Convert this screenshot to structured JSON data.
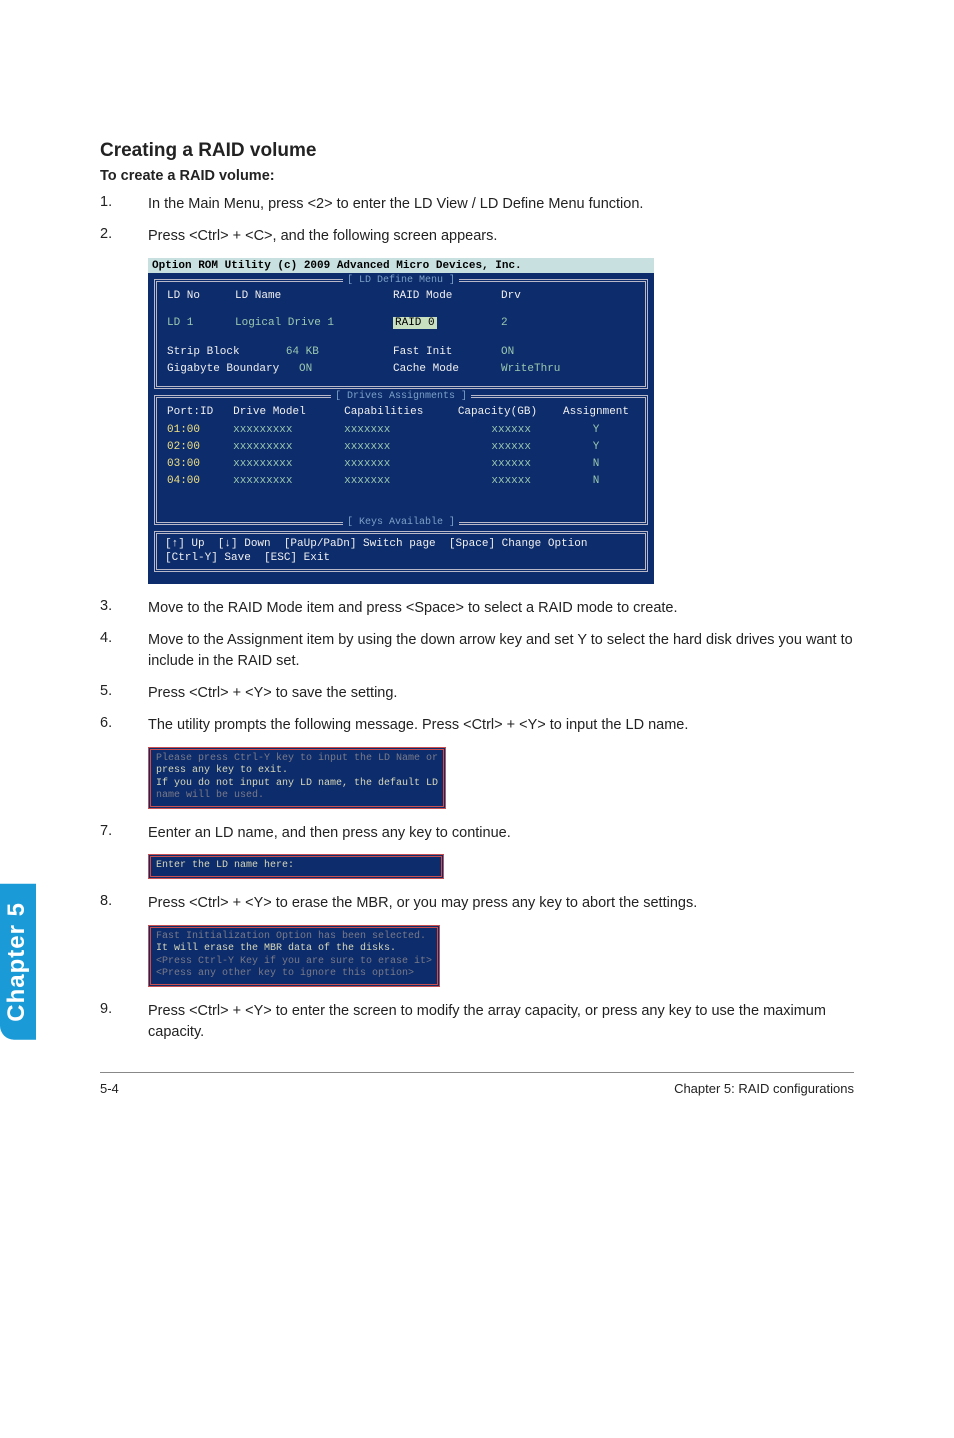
{
  "section": {
    "title": "Creating a RAID volume",
    "subhead": "To create a RAID volume:"
  },
  "steps": {
    "n1": "1.",
    "t1": "In the Main Menu, press <2> to enter the LD View / LD Define Menu function.",
    "n2": "2.",
    "t2": "Press <Ctrl> + <C>, and the following screen appears.",
    "n3": "3.",
    "t3": "Move to the RAID Mode item and press <Space> to select a RAID mode to create.",
    "n4": "4.",
    "t4": "Move to the Assignment item by using the down arrow key and set Y to select the hard disk drives you want to include in the RAID set.",
    "n5": "5.",
    "t5": "Press <Ctrl> + <Y> to save the setting.",
    "n6": "6.",
    "t6": "The utility prompts the following message. Press <Ctrl> + <Y> to input the LD name.",
    "n7": "7.",
    "t7": "Eenter an LD name, and then press any key to continue.",
    "n8": "8.",
    "t8": "Press <Ctrl> + <Y> to erase the MBR, or you may press any key to abort the settings.",
    "n9": "9.",
    "t9": "Press <Ctrl> + <Y> to enter the screen to modify the array capacity, or press any key to use the maximum capacity."
  },
  "bios": {
    "title": "Option ROM Utility (c) 2009 Advanced Micro Devices, Inc.",
    "panel1_label": "[ LD Define Menu ]",
    "panel2_label": "[ Drives Assignments ]",
    "panel3_label": "[ Keys Available ]",
    "ld_no_hdr": "LD No",
    "ld_name_hdr": "LD Name",
    "raid_mode_hdr": "RAID Mode",
    "drv_hdr": "Drv",
    "ld_row_no": "LD  1",
    "ld_row_name": "Logical Drive 1",
    "raid_mode_val": " RAID 0 ",
    "drv_val": "2",
    "strip_block_lbl": "Strip Block",
    "strip_block_val": "64 KB",
    "fast_init_lbl": "Fast Init",
    "fast_init_val": "ON",
    "gig_lbl": "Gigabyte Boundary",
    "gig_val": "ON",
    "cache_lbl": "Cache Mode",
    "cache_val": "WriteThru",
    "col_port": "Port:ID",
    "col_model": "Drive Model",
    "col_cap": "Capabilities",
    "col_size": "Capacity(GB)",
    "col_assign": "Assignment",
    "rows": [
      {
        "port": "01:00",
        "model": "xxxxxxxxx",
        "cap": "xxxxxxx",
        "size": "xxxxxx",
        "assign": "Y"
      },
      {
        "port": "02:00",
        "model": "xxxxxxxxx",
        "cap": "xxxxxxx",
        "size": "xxxxxx",
        "assign": "Y"
      },
      {
        "port": "03:00",
        "model": "xxxxxxxxx",
        "cap": "xxxxxxx",
        "size": "xxxxxx",
        "assign": "N"
      },
      {
        "port": "04:00",
        "model": "xxxxxxxxx",
        "cap": "xxxxxxx",
        "size": "xxxxxx",
        "assign": "N"
      }
    ],
    "keys_line1": "[↑] Up  [↓] Down  [PaUp/PaDn] Switch page  [Space] Change Option",
    "keys_line2": "[Ctrl-Y] Save  [ESC] Exit"
  },
  "dlg1": {
    "l1": "Please press Ctrl-Y key to input the LD Name or",
    "l2": "press any key to exit.",
    "l3": "If you do not input any LD name, the default LD",
    "l4": "name will be used."
  },
  "dlg2": {
    "l1": "Enter the LD name here:"
  },
  "dlg3": {
    "l1": "Fast Initialization Option has been selected.",
    "l2": "It will erase the MBR data of the disks.",
    "l3": "<Press Ctrl-Y Key if you are sure to erase it>",
    "l4": "<Press any other key to ignore this option>"
  },
  "sidetab": "Chapter 5",
  "footer": {
    "left": "5-4",
    "right": "Chapter 5: RAID configurations"
  }
}
